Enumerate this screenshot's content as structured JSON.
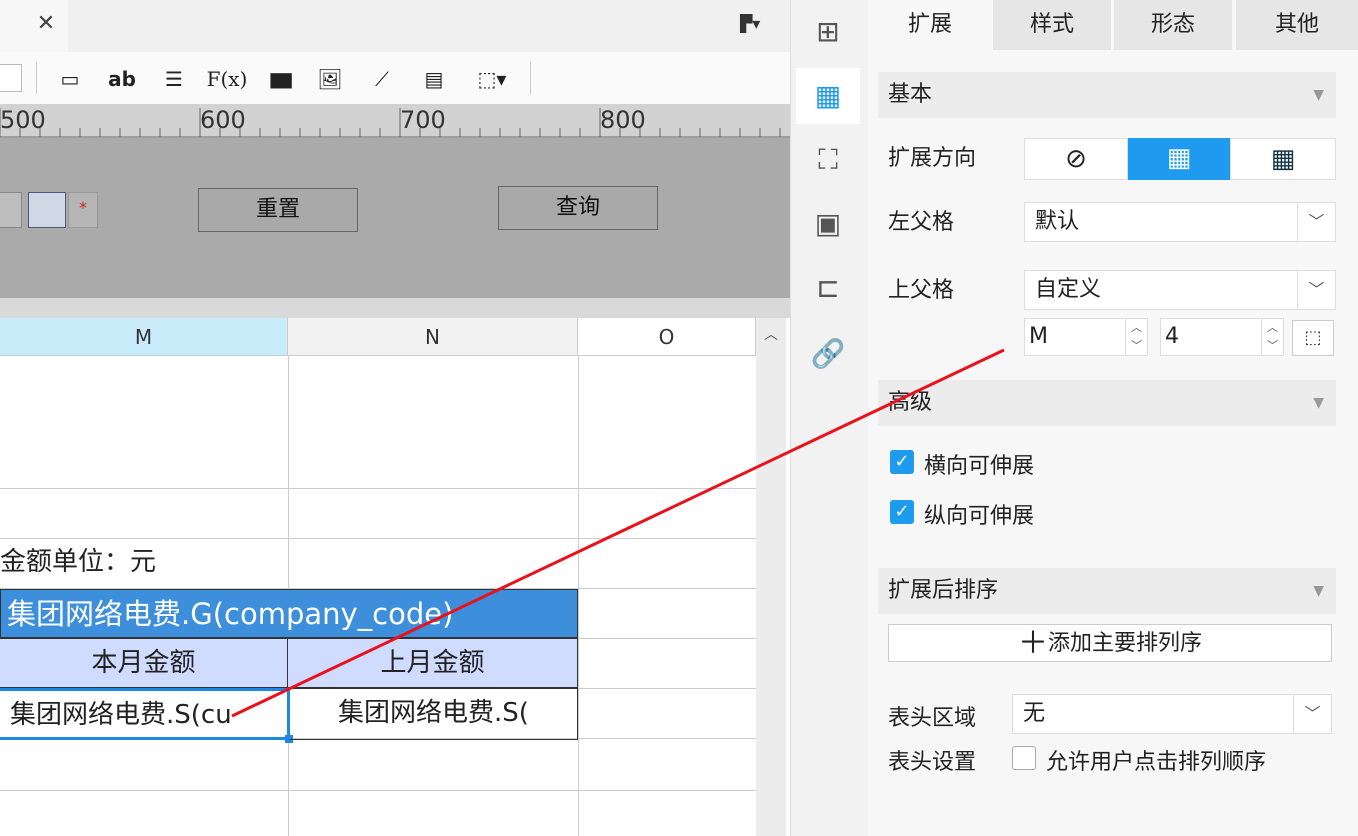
{
  "tab": {
    "close": "✕"
  },
  "toolbar": {
    "items": [
      "▭",
      "ab",
      "☰",
      "F(x)",
      "▮▮▮",
      "🖼",
      "⟋",
      "▤",
      "⬚▾"
    ]
  },
  "ruler": {
    "labels": [
      "500",
      "600",
      "700",
      "800"
    ]
  },
  "param": {
    "reset_label": "重置",
    "query_label": "查询",
    "required_mark": "*"
  },
  "grid": {
    "columns": [
      "M",
      "N",
      "O"
    ],
    "unit_label": "金额单位：元",
    "group_cell": "集团网络电费.G(company_code)",
    "header_cells": [
      "本月金额",
      "上月金额"
    ],
    "data_cells": [
      "集团网络电费.S(cu",
      "集团网络电费.S("
    ]
  },
  "panel": {
    "tabs": [
      "扩展",
      "样式",
      "形态",
      "其他"
    ],
    "basic": {
      "title": "基本",
      "direction_label": "扩展方向",
      "left_parent_label": "左父格",
      "left_parent_value": "默认",
      "top_parent_label": "上父格",
      "top_parent_value": "自定义",
      "col_value": "M",
      "row_value": "4"
    },
    "advanced": {
      "title": "高级",
      "h_expand": "横向可伸展",
      "v_expand": "纵向可伸展"
    },
    "sort": {
      "title": "扩展后排序",
      "add_label": "添加主要排列序"
    },
    "header_area_label": "表头区域",
    "header_area_value": "无",
    "header_setting_label": "表头设置",
    "header_setting_value": "允许用户点击排列顺序"
  },
  "colors": {
    "accent": "#1e9bef",
    "group_bg": "#3d8fdc",
    "header_bg": "#cfdcff",
    "arrow": "#e8121c"
  }
}
